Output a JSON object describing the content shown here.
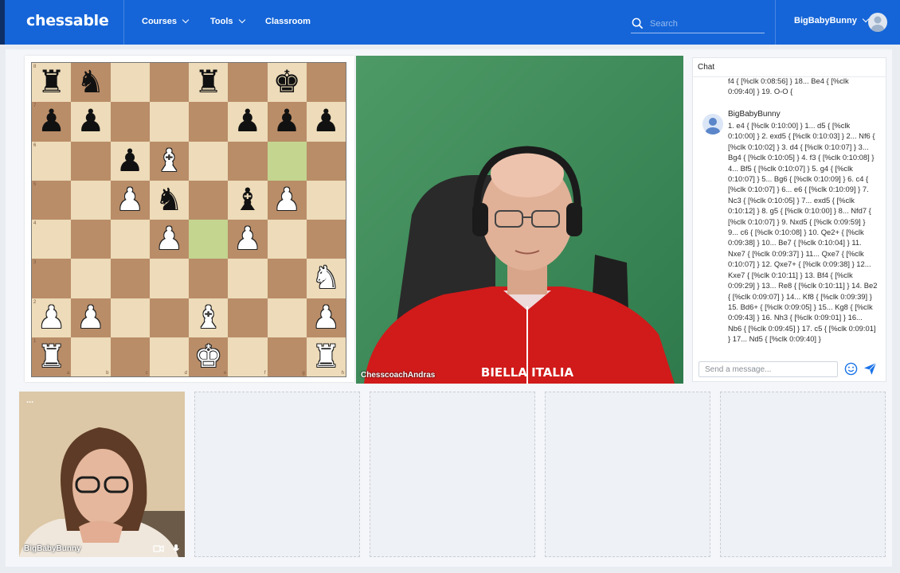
{
  "nav": {
    "logo": "chessable",
    "courses_label": "Courses",
    "tools_label": "Tools",
    "classroom_label": "Classroom",
    "search_placeholder": "Search",
    "username": "BigBabyBunny"
  },
  "board": {
    "highlight_color": "#a9c47b",
    "light_color": "#eddbb9",
    "dark_color": "#b98d68",
    "position": [
      [
        "r",
        "n",
        "",
        "",
        "r",
        "",
        "k",
        ""
      ],
      [
        "p",
        "p",
        "",
        "",
        "",
        "p",
        "p",
        "p"
      ],
      [
        "",
        "",
        "p",
        "B",
        "",
        "",
        "",
        ""
      ],
      [
        "",
        "",
        "P",
        "n",
        "",
        "b",
        "P",
        ""
      ],
      [
        "",
        "",
        "",
        "P",
        "",
        "P",
        "",
        ""
      ],
      [
        "",
        "",
        "",
        "",
        "",
        "",
        "",
        "N"
      ],
      [
        "P",
        "P",
        "",
        "",
        "B",
        "",
        "",
        "P"
      ],
      [
        "R",
        "",
        "",
        "",
        "K",
        "",
        "",
        "R"
      ]
    ],
    "highlighted_squares": [
      "g6",
      "e4"
    ],
    "rank_labels": [
      "8",
      "7",
      "6",
      "5",
      "4",
      "3",
      "2",
      "1"
    ],
    "file_labels": [
      "a",
      "b",
      "c",
      "d",
      "e",
      "f",
      "g",
      "h"
    ]
  },
  "main_video": {
    "name": "ChesscoachAndras",
    "jacket_text": "BIELLA  ITALIA"
  },
  "chat": {
    "title": "Chat",
    "previous_snippet": "f4 { [%clk 0:08:56] } 18... Be4 { [%clk 0:09:40] } 19. O-O {",
    "messages": [
      {
        "sender": "BigBabyBunny",
        "text": "1. e4 { [%clk 0:10:00] } 1... d5 { [%clk 0:10:00] } 2. exd5 { [%clk 0:10:03] } 2... Nf6 { [%clk 0:10:02] } 3. d4 { [%clk 0:10:07] } 3... Bg4 { [%clk 0:10:05] } 4. f3 { [%clk 0:10:08] } 4... Bf5 { [%clk 0:10:07] } 5. g4 { [%clk 0:10:07] } 5... Bg6 { [%clk 0:10:09] } 6. c4 { [%clk 0:10:07] } 6... e6 { [%clk 0:10:09] } 7. Nc3 { [%clk 0:10:05] } 7... exd5 { [%clk 0:10:12] } 8. g5 { [%clk 0:10:00] } 8... Nfd7 { [%clk 0:10:07] } 9. Nxd5 { [%clk 0:09:59] } 9... c6 { [%clk 0:10:08] } 10. Qe2+ { [%clk 0:09:38] } 10... Be7 { [%clk 0:10:04] } 11. Nxe7 { [%clk 0:09:37] } 11... Qxe7 { [%clk 0:10:07] } 12. Qxe7+ { [%clk 0:09:38] } 12... Kxe7 { [%clk 0:10:11] } 13. Bf4 { [%clk 0:09:29] } 13... Re8 { [%clk 0:10:11] } 14. Be2 { [%clk 0:09:07] } 14... Kf8 { [%clk 0:09:39] } 15. Bd6+ { [%clk 0:09:05] } 15... Kg8 { [%clk 0:09:43] } 16. Nh3 { [%clk 0:09:01] } 16... Nb6 { [%clk 0:09:45] } 17. c5 { [%clk 0:09:01] } 17... Nd5 { [%clk 0:09:40] }"
      }
    ],
    "input_placeholder": "Send a message...",
    "accent_color": "#1a73e8"
  },
  "participants": {
    "self_name": "BigBabyBunny",
    "menu_dots": "..."
  },
  "icons": {
    "search": "search-icon",
    "emoji": "emoji-icon",
    "send": "send-icon",
    "camera": "camera-off-icon",
    "mic": "mic-icon"
  }
}
